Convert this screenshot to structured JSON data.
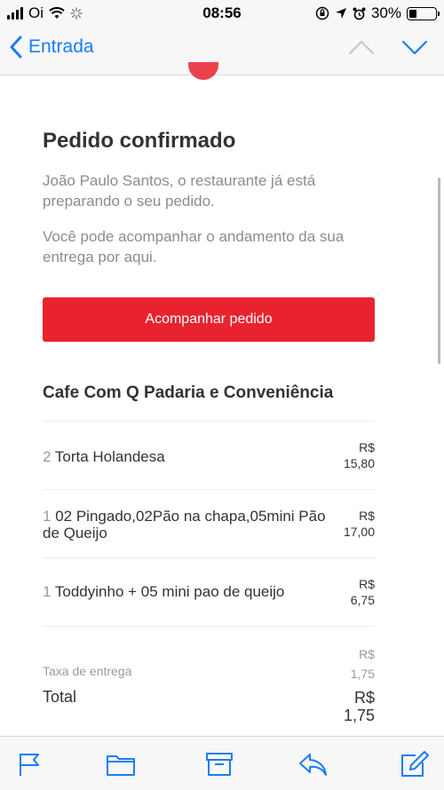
{
  "status_bar": {
    "carrier": "Oi",
    "time": "08:56",
    "battery": "30%",
    "battery_level": 0.3
  },
  "nav": {
    "back_label": "Entrada"
  },
  "email": {
    "title": "Pedido confirmado",
    "paragraph1": "João Paulo Santos, o restaurante já está preparando o seu pedido.",
    "paragraph2": "Você pode acompanhar o andamento da sua entrega por aqui.",
    "track_button_label": "Acompanhar pedido",
    "store_name": "Cafe Com Q Padaria e Conveniência",
    "items": [
      {
        "qty": "2",
        "name": "Torta Holandesa",
        "currency": "R$",
        "price": "15,80"
      },
      {
        "qty": "1",
        "name": "02 Pingado,02Pão na chapa,05mini Pão de Queijo",
        "currency": "R$",
        "price": "17,00"
      },
      {
        "qty": "1",
        "name": "Toddyinho + 05 mini pao de queijo",
        "currency": "R$",
        "price": "6,75"
      }
    ],
    "delivery_fee_label": "Taxa de entrega",
    "delivery_fee_currency": "R$",
    "delivery_fee": "1,75",
    "total_label": "Total",
    "total_currency": "R$",
    "total": "1,75"
  },
  "colors": {
    "accent": "#1a7cf5",
    "brand_red": "#e8232f"
  },
  "toolbar_icons": [
    "flag-icon",
    "folder-icon",
    "archive-icon",
    "reply-icon",
    "compose-icon"
  ]
}
